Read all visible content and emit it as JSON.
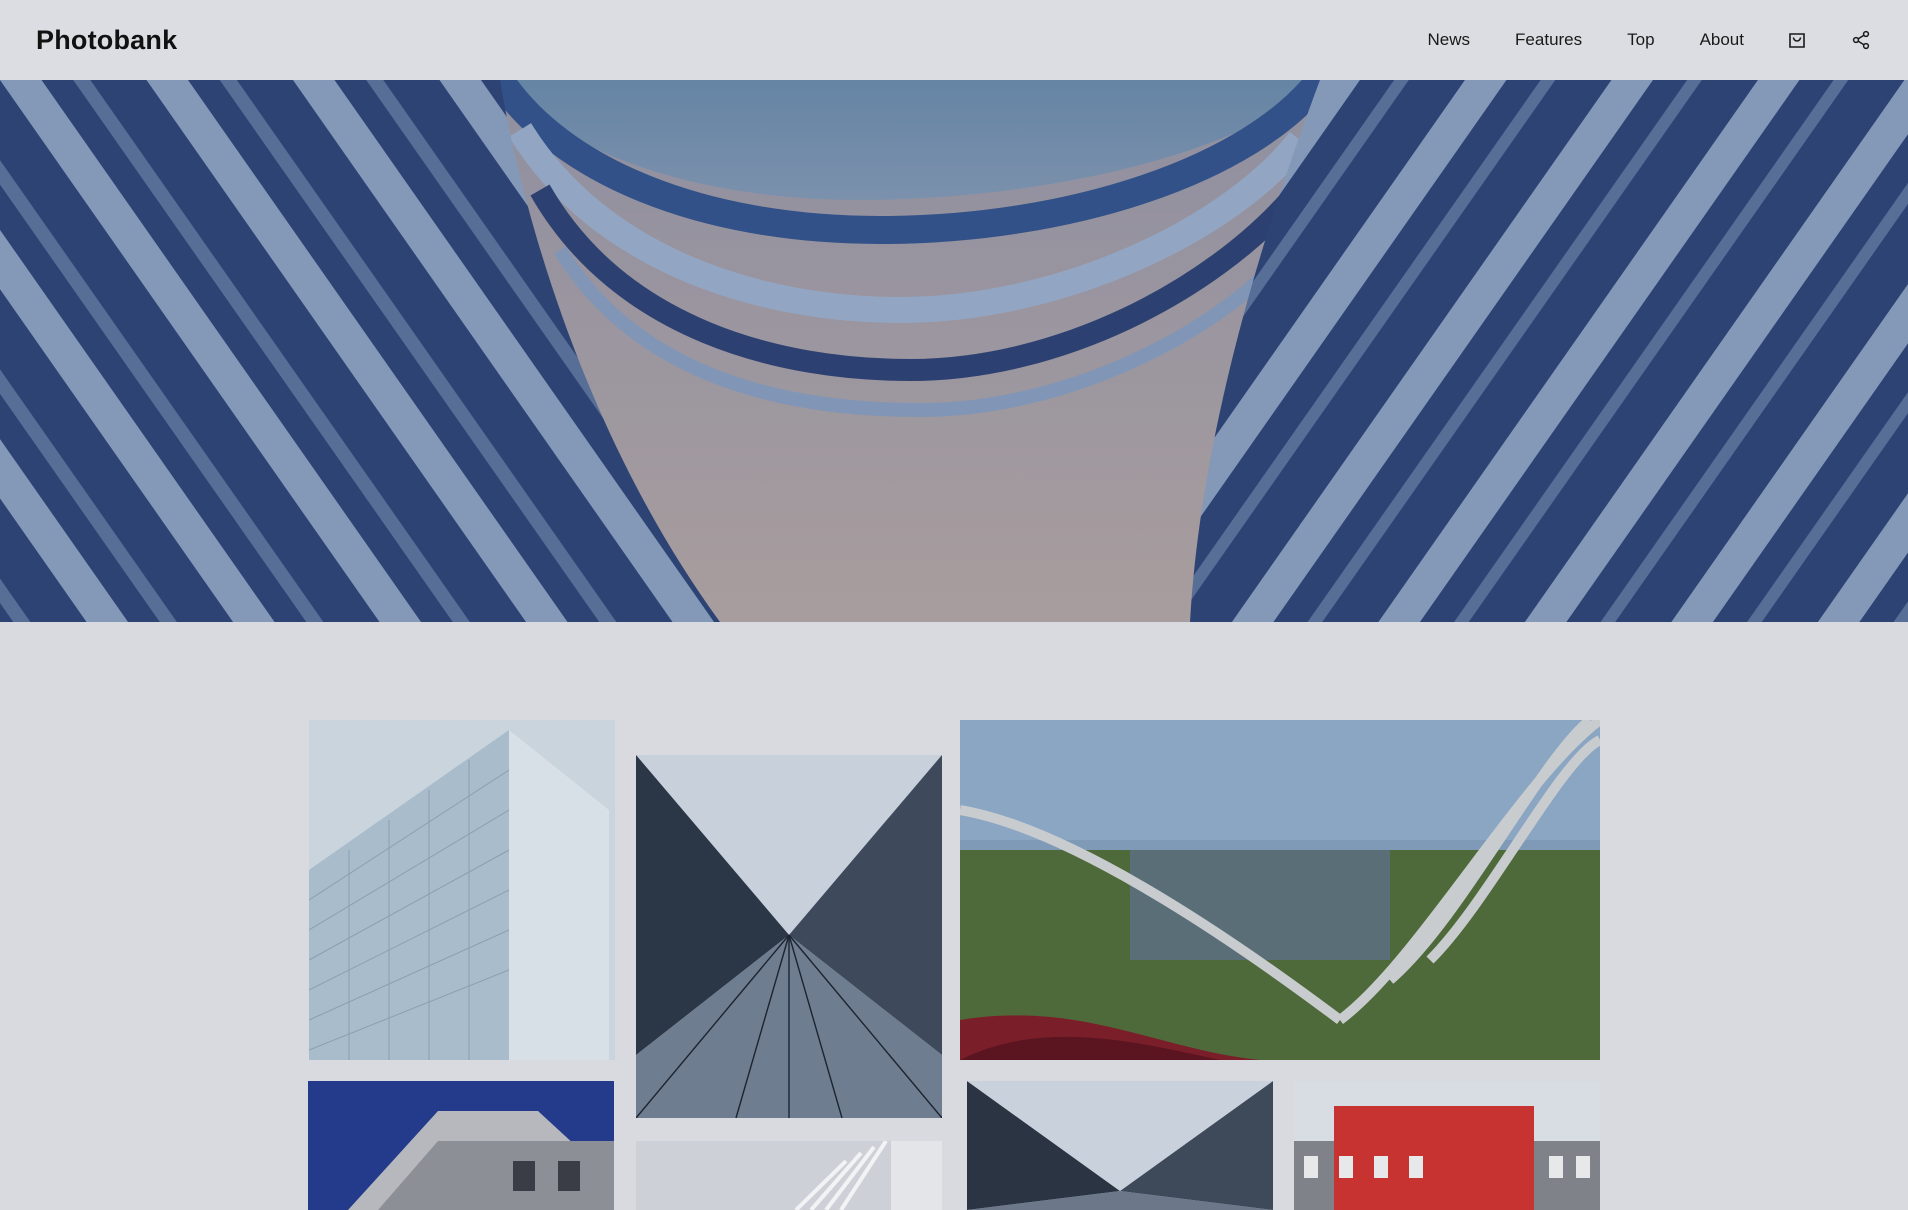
{
  "header": {
    "brand": "Photobank",
    "nav": [
      {
        "label": "News"
      },
      {
        "label": "Features"
      },
      {
        "label": "Top"
      },
      {
        "label": "About"
      }
    ],
    "icons": [
      "bag-icon",
      "share-icon"
    ]
  },
  "colors": {
    "page_bg": "#d9dadf",
    "header_bg": "#dcdde2",
    "text": "#111111",
    "hero_blue": "#3a4e7e"
  }
}
